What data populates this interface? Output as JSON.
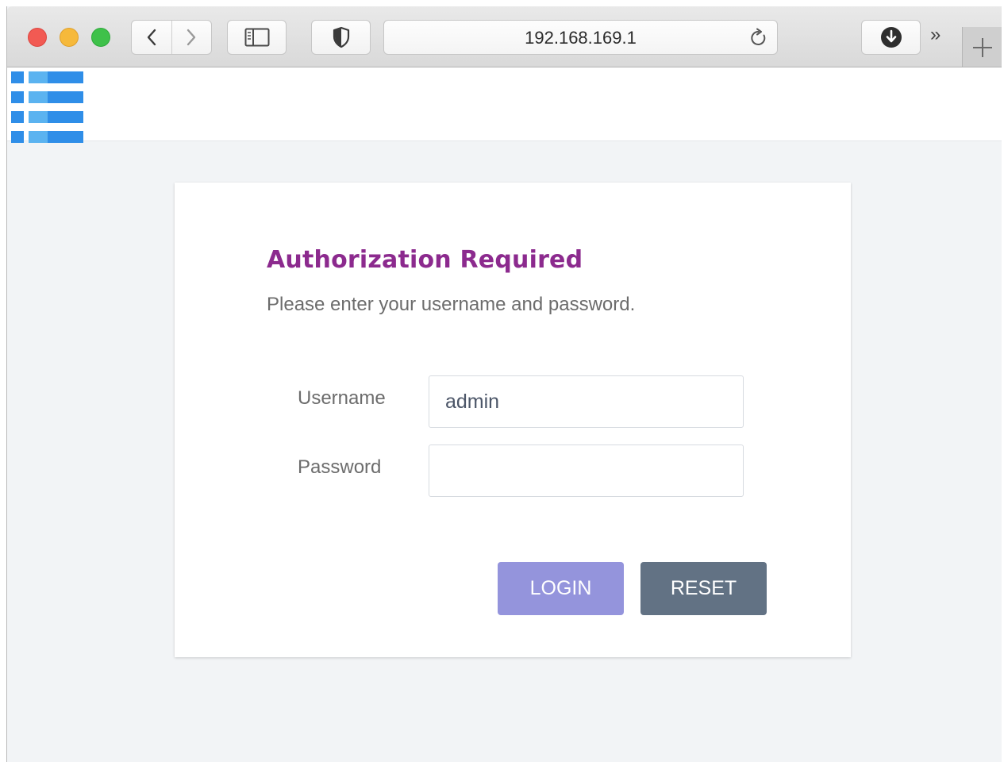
{
  "browser": {
    "url": "192.168.169.1",
    "traffic_lights": [
      "close",
      "minimize",
      "zoom"
    ],
    "toolbar_icons": [
      "back-icon",
      "forward-icon",
      "sidebar-icon",
      "privacy-shield-icon",
      "reload-icon",
      "downloads-icon",
      "more-chevrons-icon",
      "new-tab-icon"
    ],
    "more_glyph": "»"
  },
  "header": {
    "logo_icon": "router-logo-icon",
    "logo_colors": [
      "#2f8ee8",
      "#5bb3f0",
      "#2f8ee8"
    ]
  },
  "login": {
    "title": "Authorization Required",
    "subtitle": "Please enter your username and password.",
    "username_label": "Username",
    "username_value": "admin",
    "password_label": "Password",
    "password_value": "",
    "login_button": "LOGIN",
    "reset_button": "RESET"
  },
  "colors": {
    "title": "#8c2a8e",
    "login_button": "#9494dc",
    "reset_button": "#627284",
    "page_background": "#f2f4f6"
  }
}
